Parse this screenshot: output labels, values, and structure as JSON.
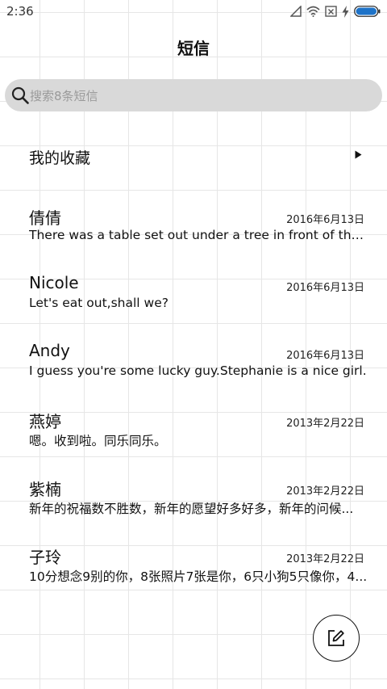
{
  "status_bar": {
    "time": "2:36",
    "icons": [
      "signal-icon",
      "wifi-icon",
      "sim-icon",
      "charging-icon",
      "battery-icon"
    ],
    "battery_color": "#1e73c8"
  },
  "header": {
    "title": "短信"
  },
  "search": {
    "placeholder": "搜索8条短信",
    "icon": "search-icon"
  },
  "favorites": {
    "label": "我的收藏",
    "icon": "arrow-right-icon"
  },
  "messages": [
    {
      "name": "倩倩",
      "date": "2016年6月13日",
      "preview": "There was a table set out under a tree in front of the ho..."
    },
    {
      "name": "Nicole",
      "date": "2016年6月13日",
      "preview": "Let's eat out,shall we?"
    },
    {
      "name": "Andy",
      "date": "2016年6月13日",
      "preview": "I guess you're some lucky guy.Stephanie is a nice girl."
    },
    {
      "name": "燕婷",
      "date": "2013年2月22日",
      "preview": "嗯。收到啦。同乐同乐。"
    },
    {
      "name": "紫楠",
      "date": "2013年2月22日",
      "preview": "新年的祝福数不胜数，新年的愿望好多好多，新年的问候..."
    },
    {
      "name": "子玲",
      "date": "2013年2月22日",
      "preview": "10分想念9别的你，8张照片7张是你，6只小狗5只像你，4..."
    }
  ],
  "compose": {
    "icon": "compose-icon"
  }
}
